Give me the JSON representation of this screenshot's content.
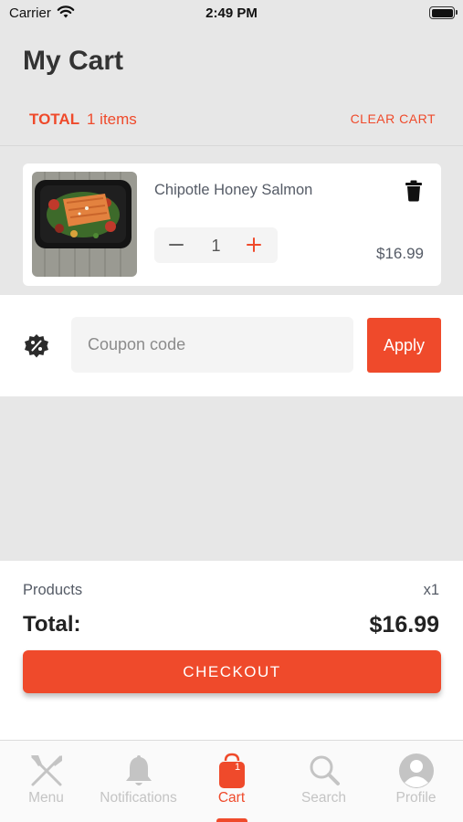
{
  "status_bar": {
    "carrier": "Carrier",
    "time": "2:49 PM"
  },
  "header": {
    "title": "My Cart",
    "total_label": "TOTAL",
    "items_count": "1 items",
    "clear_cart_label": "CLEAR CART"
  },
  "cart": {
    "items": [
      {
        "name": "Chipotle Honey Salmon",
        "quantity": "1",
        "price": "$16.99",
        "image_icon": "salmon-meal-photo"
      }
    ]
  },
  "coupon": {
    "placeholder": "Coupon code",
    "apply_label": "Apply",
    "icon": "discount-badge-icon"
  },
  "summary": {
    "products_label": "Products",
    "products_count": "x1",
    "total_label": "Total:",
    "total_value": "$16.99",
    "checkout_label": "CHECKOUT"
  },
  "tab_bar": {
    "tabs": [
      {
        "label": "Menu",
        "icon": "utensils-icon"
      },
      {
        "label": "Notifications",
        "icon": "bell-icon"
      },
      {
        "label": "Cart",
        "icon": "cart-bag-icon",
        "badge": "1",
        "active": true
      },
      {
        "label": "Search",
        "icon": "search-icon"
      },
      {
        "label": "Profile",
        "icon": "profile-icon"
      }
    ]
  },
  "colors": {
    "accent": "#ef4a2b",
    "background": "#e7e7e7",
    "text_muted": "#555b66",
    "inactive_tab": "#c4c4c4"
  }
}
